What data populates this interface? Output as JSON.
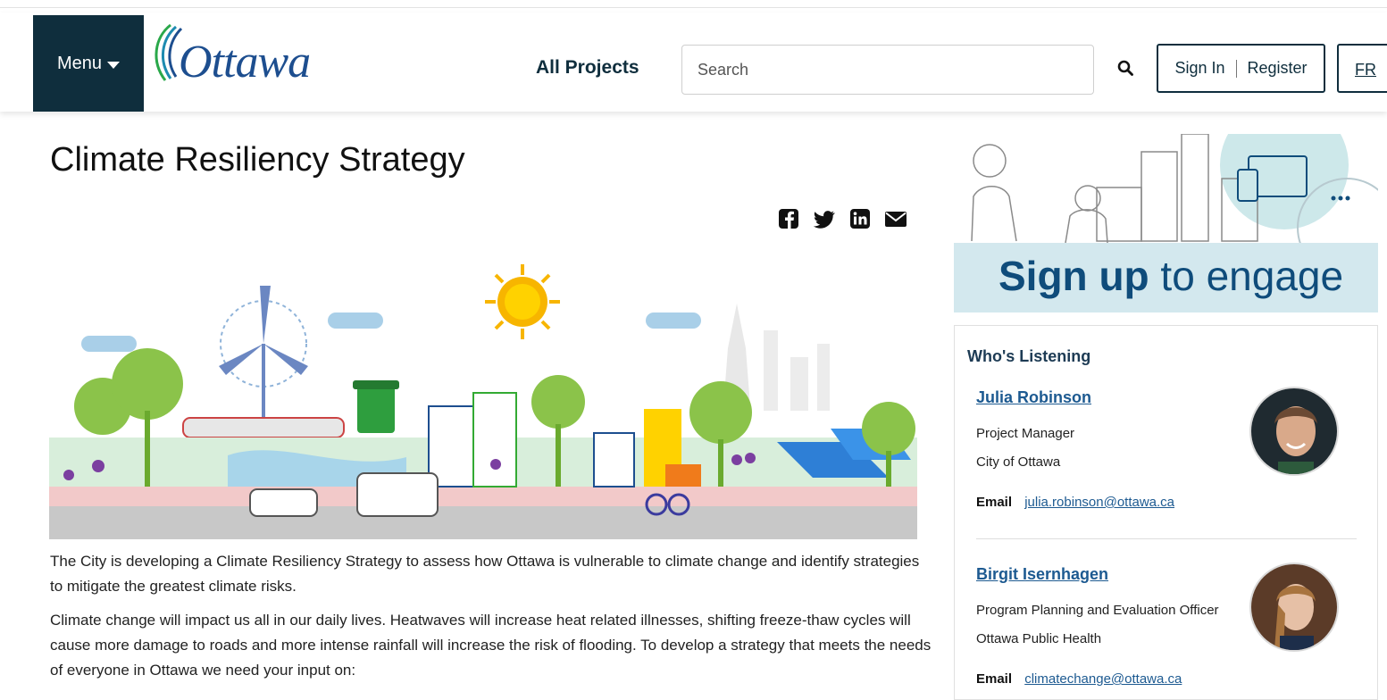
{
  "header": {
    "menu_label": "Menu",
    "logo_text": "Ottawa",
    "all_projects_label": "All Projects",
    "search_placeholder": "Search",
    "sign_in_label": "Sign In",
    "register_label": "Register",
    "language_label": "FR"
  },
  "page": {
    "title": "Climate Resiliency Strategy",
    "share_icons": [
      "facebook-icon",
      "twitter-icon",
      "linkedin-icon",
      "email-icon"
    ],
    "paragraphs": [
      "The City is developing a Climate Resiliency Strategy to assess how Ottawa is vulnerable to climate change and identify strategies to mitigate the greatest climate risks.",
      "Climate change will impact us all in our daily lives. Heatwaves will increase heat related illnesses, shifting freeze-thaw cycles will cause more damage to roads and more intense rainfall will increase the risk of flooding. To develop a strategy that meets the needs of everyone in Ottawa we need your input on:"
    ]
  },
  "sidebar": {
    "banner_bold": "Sign up",
    "banner_rest": " to engage",
    "panel_title": "Who's Listening",
    "people": [
      {
        "name": "Julia Robinson",
        "role": "Project Manager",
        "org": "City of Ottawa",
        "email_label": "Email",
        "email": "julia.robinson@ottawa.ca"
      },
      {
        "name": "Birgit Isernhagen",
        "role": "Program Planning and Evaluation Officer",
        "org": "Ottawa Public Health",
        "email_label": "Email",
        "email": "climatechange@ottawa.ca"
      }
    ]
  },
  "colors": {
    "brand_dark": "#0f2e3d",
    "link_blue": "#1d5a91",
    "banner_band": "#d3e8ee"
  }
}
